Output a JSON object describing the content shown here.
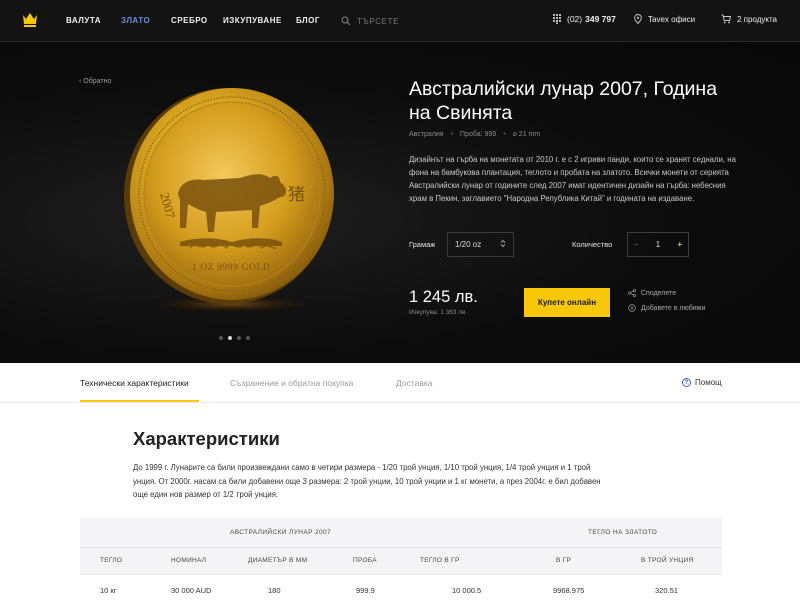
{
  "header": {
    "nav": [
      {
        "label": "ВАЛУТА",
        "active": false
      },
      {
        "label": "ЗЛАТО",
        "active": true
      },
      {
        "label": "СРЕБРО",
        "active": false
      },
      {
        "label": "ИЗКУПУВАНЕ",
        "active": false
      },
      {
        "label": "БЛОГ",
        "active": false
      }
    ],
    "search_placeholder": "ТЪРСЕТЕ",
    "phone_prefix": "(02)",
    "phone_number": "349 797",
    "offices": "Tavex офиси",
    "cart": "2 продукта"
  },
  "product": {
    "back": "Обратно",
    "title": "Австралийски лунар 2007, Година на Свинята",
    "meta": [
      "Австралия",
      "Проба: 999",
      "⌀ 21 mm"
    ],
    "description": "Дизайнът на гърба на монетата от 2010 г. е с 2 игриви панди, които се хранят седнали, на фона на бамбукова плантация, теглото и пробата на златото. Всички монети от серията Австралийски лунар от годините след 2007 имат идентичен дизайн на гърба: небесния храм в Пекин, заглавието \"Народна Република Китай\" и годината на издаване.",
    "weight_label": "Грамаж",
    "weight_value": "1/20 oz",
    "quantity_label": "Количество",
    "quantity_value": "1",
    "minus": "−",
    "plus": "+",
    "price": "1 245 лв.",
    "buyback": "Изкупува: 1 363 лв.",
    "buy_button": "Купете онлайн",
    "share": "Споделете",
    "favorites": "Добавете в любими",
    "carousel_active": 1,
    "coin": {
      "year": "2007",
      "inscription": "1 OZ 9999 GOLD",
      "glyph": "猪"
    }
  },
  "tabs": [
    {
      "label": "Технически характеристики",
      "active": true
    },
    {
      "label": "Съхранение и обратна покупка",
      "active": false
    },
    {
      "label": "Доставка",
      "active": false
    }
  ],
  "help": "Помощ",
  "characteristics": {
    "title": "Характеристики",
    "text": "До 1999 г. Лунарите са били произвеждани само в четири размера - 1/20 трой унция, 1/10 трой унция, 1/4 трой унция и 1 трой унция. От 2000г. насам са били добавени още 3 размера: 2 трой унции, 10 трой унции и 1 кг монети, а през 2004г. е бил добавен още един нов размер от 1/2 трой унция."
  },
  "table": {
    "group_left": "АВСТРАЛИЙСКИ ЛУНАР 2007",
    "group_right": "ТЕГЛО НА ЗЛАТОТО",
    "columns": [
      "ТЕГЛО",
      "НОМИНАЛ",
      "ДИАМЕТЪР В ММ",
      "ПРОБА",
      "ТЕГЛО В ГР",
      "В ГР",
      "В ТРОЙ УНЦИЯ"
    ],
    "rows": [
      [
        "10 кг",
        "30 000 AUD",
        "180",
        "999.9",
        "10 000.5",
        "9968.975",
        "320.51"
      ]
    ]
  },
  "colors": {
    "accent": "#f7c70a",
    "nav_active": "#6d8dd6",
    "hero_bg": "#0c0c0c",
    "gold": "#d9a520"
  }
}
